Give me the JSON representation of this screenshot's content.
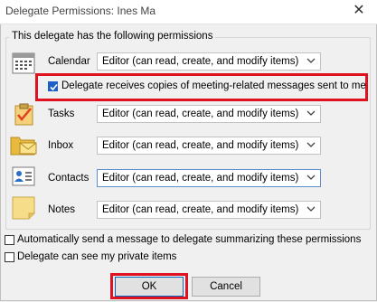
{
  "window": {
    "title": "Delegate Permissions: Ines Ma",
    "close_glyph": "✕"
  },
  "group_label": "This delegate has the following permissions",
  "rows": [
    {
      "label": "Calendar",
      "value": "Editor (can read, create, and modify items)",
      "icon": "calendar-icon"
    },
    {
      "label": "Tasks",
      "value": "Editor (can read, create, and modify items)",
      "icon": "tasks-icon"
    },
    {
      "label": "Inbox",
      "value": "Editor (can read, create, and modify items)",
      "icon": "inbox-icon"
    },
    {
      "label": "Contacts",
      "value": "Editor (can read, create, and modify items)",
      "icon": "contacts-icon"
    },
    {
      "label": "Notes",
      "value": "Editor (can read, create, and modify items)",
      "icon": "notes-icon"
    }
  ],
  "delegate_copy": {
    "label": "Delegate receives copies of meeting-related messages sent to me",
    "checked": true
  },
  "options": [
    {
      "label": "Automatically send a message to delegate summarizing these permissions",
      "checked": false
    },
    {
      "label": "Delegate can see my private items",
      "checked": false
    }
  ],
  "buttons": {
    "ok": "OK",
    "cancel": "Cancel"
  },
  "colors": {
    "highlight_red": "#e0121f",
    "check_blue": "#1e5ec8",
    "focus_border": "#5a8fd1"
  }
}
